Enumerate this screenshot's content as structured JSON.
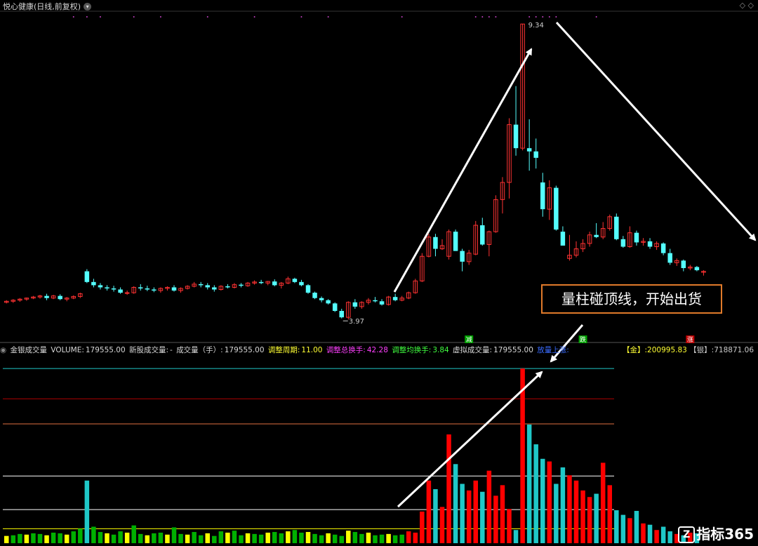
{
  "header": {
    "title": "悦心健康(日线,前复权)",
    "dropdown_glyph": "▾",
    "corner_glyphs": "◇ ◇"
  },
  "indicator": {
    "name": "金银成交量",
    "volume_label": "VOLUME:",
    "volume_value": "179555.00",
    "new_stock_label": "新股成交量:",
    "new_stock_value": "-",
    "chengjiao_label": "成交量（手）:",
    "chengjiao_value": "179555.00",
    "period_label": "调整周期:",
    "period_value": "11.00",
    "total_turnover_label": "调整总换手:",
    "total_turnover_value": "42.28",
    "avg_turnover_label": "调整均换手:",
    "avg_turnover_value": "3.84",
    "virtual_label": "虚拟成交量:",
    "virtual_value": "179555.00",
    "lastday_label": "放量上涨:",
    "lastday_value": "",
    "gold_label": "【金】:",
    "gold_value": "200995.83",
    "silver_label": "【银】:",
    "silver_value": "718871.06"
  },
  "annotation": {
    "text": "量柱碰顶线，开始出货"
  },
  "logo": {
    "mark": "Z",
    "text": "指标365"
  },
  "colors": {
    "background": "#000000",
    "up_candle": "#ff3232",
    "down_candle": "#54ffff",
    "red_volume": "#ff0000",
    "cyan_volume": "#1fc8c8",
    "yellow_volume": "#ffff00",
    "green_volume": "#00b000",
    "gridline": "#b00000",
    "arrow": "#ffffff",
    "label_yellow": "#ffff33",
    "label_magenta": "#ff40ff",
    "label_green": "#40ff40",
    "label_blue": "#3a6cff",
    "annotation_border": "#e07a2a"
  },
  "chart_data": [
    {
      "type": "candlestick",
      "title": "悦心健康(日线,前复权)",
      "ylim": [
        3.6,
        9.5
      ],
      "labels": {
        "high": "9.34",
        "low": "3.97"
      },
      "signal_tags": [
        "减",
        "跌",
        "涨"
      ],
      "candles": [
        [
          4.14,
          4.18,
          4.12,
          4.16
        ],
        [
          4.16,
          4.2,
          4.13,
          4.18
        ],
        [
          4.18,
          4.22,
          4.15,
          4.2
        ],
        [
          4.2,
          4.23,
          4.17,
          4.22
        ],
        [
          4.22,
          4.26,
          4.2,
          4.24
        ],
        [
          4.24,
          4.28,
          4.21,
          4.26
        ],
        [
          4.26,
          4.3,
          4.18,
          4.22
        ],
        [
          4.22,
          4.28,
          4.2,
          4.26
        ],
        [
          4.26,
          4.29,
          4.18,
          4.2
        ],
        [
          4.2,
          4.24,
          4.16,
          4.22
        ],
        [
          4.22,
          4.27,
          4.2,
          4.25
        ],
        [
          4.25,
          4.32,
          4.22,
          4.3
        ],
        [
          4.72,
          4.76,
          4.5,
          4.52
        ],
        [
          4.52,
          4.58,
          4.42,
          4.46
        ],
        [
          4.46,
          4.5,
          4.38,
          4.42
        ],
        [
          4.42,
          4.46,
          4.36,
          4.4
        ],
        [
          4.4,
          4.45,
          4.34,
          4.38
        ],
        [
          4.38,
          4.42,
          4.3,
          4.32
        ],
        [
          4.32,
          4.36,
          4.28,
          4.32
        ],
        [
          4.32,
          4.44,
          4.3,
          4.42
        ],
        [
          4.42,
          4.48,
          4.36,
          4.4
        ],
        [
          4.4,
          4.45,
          4.35,
          4.38
        ],
        [
          4.38,
          4.42,
          4.33,
          4.36
        ],
        [
          4.36,
          4.42,
          4.32,
          4.4
        ],
        [
          4.4,
          4.44,
          4.36,
          4.42
        ],
        [
          4.42,
          4.46,
          4.34,
          4.36
        ],
        [
          4.36,
          4.42,
          4.32,
          4.4
        ],
        [
          4.4,
          4.46,
          4.38,
          4.44
        ],
        [
          4.44,
          4.52,
          4.42,
          4.48
        ],
        [
          4.48,
          4.52,
          4.42,
          4.46
        ],
        [
          4.46,
          4.5,
          4.38,
          4.42
        ],
        [
          4.42,
          4.46,
          4.34,
          4.38
        ],
        [
          4.38,
          4.46,
          4.36,
          4.44
        ],
        [
          4.44,
          4.48,
          4.4,
          4.42
        ],
        [
          4.42,
          4.5,
          4.4,
          4.47
        ],
        [
          4.47,
          4.5,
          4.42,
          4.45
        ],
        [
          4.45,
          4.52,
          4.43,
          4.5
        ],
        [
          4.5,
          4.55,
          4.47,
          4.52
        ],
        [
          4.52,
          4.56,
          4.48,
          4.5
        ],
        [
          4.5,
          4.54,
          4.46,
          4.53
        ],
        [
          4.53,
          4.57,
          4.44,
          4.46
        ],
        [
          4.46,
          4.52,
          4.4,
          4.5
        ],
        [
          4.5,
          4.62,
          4.48,
          4.58
        ],
        [
          4.58,
          4.6,
          4.5,
          4.52
        ],
        [
          4.52,
          4.56,
          4.44,
          4.46
        ],
        [
          4.46,
          4.48,
          4.3,
          4.32
        ],
        [
          4.32,
          4.34,
          4.2,
          4.22
        ],
        [
          4.22,
          4.25,
          4.14,
          4.18
        ],
        [
          4.18,
          4.2,
          4.1,
          4.12
        ],
        [
          4.12,
          4.14,
          3.96,
          3.98
        ],
        [
          3.98,
          4.02,
          3.84,
          3.86
        ],
        [
          3.86,
          4.16,
          3.82,
          4.14
        ],
        [
          4.14,
          4.2,
          4.02,
          4.06
        ],
        [
          4.06,
          4.16,
          4.02,
          4.14
        ],
        [
          4.14,
          4.22,
          4.1,
          4.18
        ],
        [
          4.18,
          4.24,
          4.14,
          4.16
        ],
        [
          4.16,
          4.2,
          4.08,
          4.1
        ],
        [
          4.1,
          4.26,
          4.08,
          4.24
        ],
        [
          4.24,
          4.3,
          4.16,
          4.18
        ],
        [
          4.18,
          4.26,
          4.16,
          4.22
        ],
        [
          4.22,
          4.34,
          4.2,
          4.32
        ],
        [
          4.32,
          4.58,
          4.3,
          4.54
        ],
        [
          4.54,
          5.06,
          4.52,
          5.0
        ],
        [
          5.0,
          5.42,
          4.98,
          5.36
        ],
        [
          5.36,
          5.42,
          5.0,
          5.14
        ],
        [
          5.14,
          5.32,
          5.12,
          5.2
        ],
        [
          5.0,
          5.5,
          4.94,
          5.46
        ],
        [
          5.46,
          5.5,
          5.1,
          5.1
        ],
        [
          5.1,
          5.14,
          4.72,
          4.9
        ],
        [
          4.9,
          5.12,
          4.84,
          5.06
        ],
        [
          5.04,
          5.66,
          5.02,
          5.58
        ],
        [
          5.58,
          5.72,
          5.2,
          5.22
        ],
        [
          5.22,
          5.48,
          5.0,
          5.46
        ],
        [
          5.46,
          6.14,
          5.44,
          6.06
        ],
        [
          6.06,
          6.48,
          5.8,
          6.38
        ],
        [
          6.38,
          7.58,
          6.08,
          7.46
        ],
        [
          7.46,
          8.18,
          6.88,
          7.02
        ],
        [
          7.02,
          9.34,
          6.98,
          9.34
        ],
        [
          7.02,
          7.56,
          6.6,
          6.96
        ],
        [
          6.96,
          7.2,
          6.64,
          6.84
        ],
        [
          6.38,
          6.56,
          5.74,
          5.88
        ],
        [
          5.88,
          6.42,
          5.68,
          6.28
        ],
        [
          6.28,
          6.32,
          5.48,
          5.5
        ],
        [
          5.46,
          5.56,
          5.26,
          5.2
        ],
        [
          4.96,
          5.4,
          4.92,
          5.02
        ],
        [
          5.02,
          5.28,
          4.98,
          5.14
        ],
        [
          5.14,
          5.32,
          5.08,
          5.24
        ],
        [
          5.24,
          5.46,
          5.18,
          5.4
        ],
        [
          5.4,
          5.62,
          5.34,
          5.36
        ],
        [
          5.36,
          5.64,
          5.32,
          5.52
        ],
        [
          5.52,
          5.78,
          5.48,
          5.74
        ],
        [
          5.74,
          5.8,
          5.3,
          5.32
        ],
        [
          5.32,
          5.38,
          5.16,
          5.18
        ],
        [
          5.18,
          5.56,
          5.16,
          5.44
        ],
        [
          5.44,
          5.48,
          5.2,
          5.26
        ],
        [
          5.26,
          5.34,
          5.2,
          5.28
        ],
        [
          5.28,
          5.34,
          5.14,
          5.18
        ],
        [
          5.18,
          5.28,
          5.12,
          5.24
        ],
        [
          5.24,
          5.26,
          5.02,
          5.06
        ],
        [
          5.06,
          5.14,
          4.84,
          4.88
        ],
        [
          4.88,
          4.96,
          4.82,
          4.92
        ],
        [
          4.92,
          4.94,
          4.72,
          4.78
        ],
        [
          4.78,
          4.84,
          4.74,
          4.8
        ],
        [
          4.8,
          4.82,
          4.72,
          4.74
        ],
        [
          4.7,
          4.74,
          4.64,
          4.72
        ]
      ]
    },
    {
      "type": "bar",
      "title": "金银成交量",
      "ylim": [
        0,
        280000
      ],
      "gridlines": [
        22000,
        51000,
        102000,
        181000,
        219000,
        265000
      ],
      "series": [
        {
          "name": "VOLUME",
          "values": [
            11000,
            12000,
            14000,
            13000,
            15000,
            14000,
            12000,
            16000,
            15000,
            13000,
            18000,
            22000,
            95000,
            25000,
            17000,
            15000,
            13000,
            18000,
            16000,
            27000,
            14000,
            12000,
            15000,
            16000,
            13000,
            24000,
            14000,
            13000,
            17000,
            12000,
            15000,
            11000,
            18000,
            16000,
            19000,
            12000,
            15000,
            14000,
            13000,
            16000,
            17000,
            15000,
            18000,
            20000,
            16000,
            17000,
            14000,
            12000,
            15000,
            13000,
            11000,
            19000,
            17000,
            14000,
            16000,
            12000,
            13000,
            14000,
            12000,
            13000,
            18000,
            16000,
            48000,
            95000,
            82000,
            55000,
            165000,
            120000,
            90000,
            80000,
            95000,
            78000,
            110000,
            72000,
            88000,
            52000,
            20000,
            265000,
            180000,
            150000,
            128000,
            124000,
            90000,
            115000,
            103000,
            95000,
            80000,
            70000,
            75000,
            122000,
            88000,
            50000,
            43000,
            38000,
            49000,
            30000,
            28000,
            20000,
            25000,
            18000,
            14000,
            12000,
            16000,
            15000
          ]
        }
      ]
    }
  ]
}
